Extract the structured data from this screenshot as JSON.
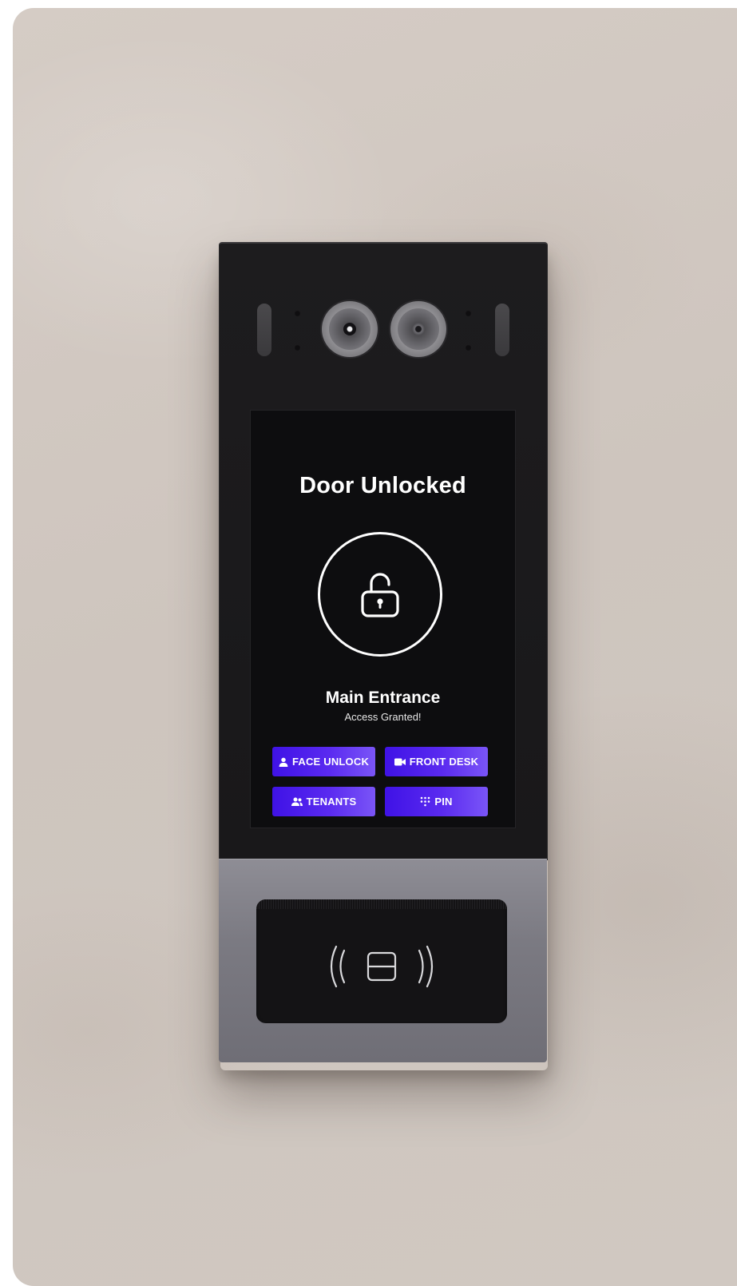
{
  "screen": {
    "title": "Door Unlocked",
    "location": "Main Entrance",
    "status": "Access Granted!"
  },
  "buttons": {
    "face_unlock": {
      "label": "FACE UNLOCK",
      "icon": "person-icon"
    },
    "front_desk": {
      "label": "FRONT DESK",
      "icon": "video-camera-icon"
    },
    "tenants": {
      "label": "TENANTS",
      "icon": "people-icon"
    },
    "pin": {
      "label": "PIN",
      "icon": "keypad-icon"
    }
  },
  "icons": {
    "status": "unlocked-padlock-icon",
    "reader": "nfc-card-icon"
  },
  "colors": {
    "button_gradient_start": "#3f12e6",
    "button_gradient_end": "#7a55f7",
    "screen_background": "#0d0d0f",
    "device_body": "#1d1c1e",
    "reader_panel": "#7b7a82"
  }
}
